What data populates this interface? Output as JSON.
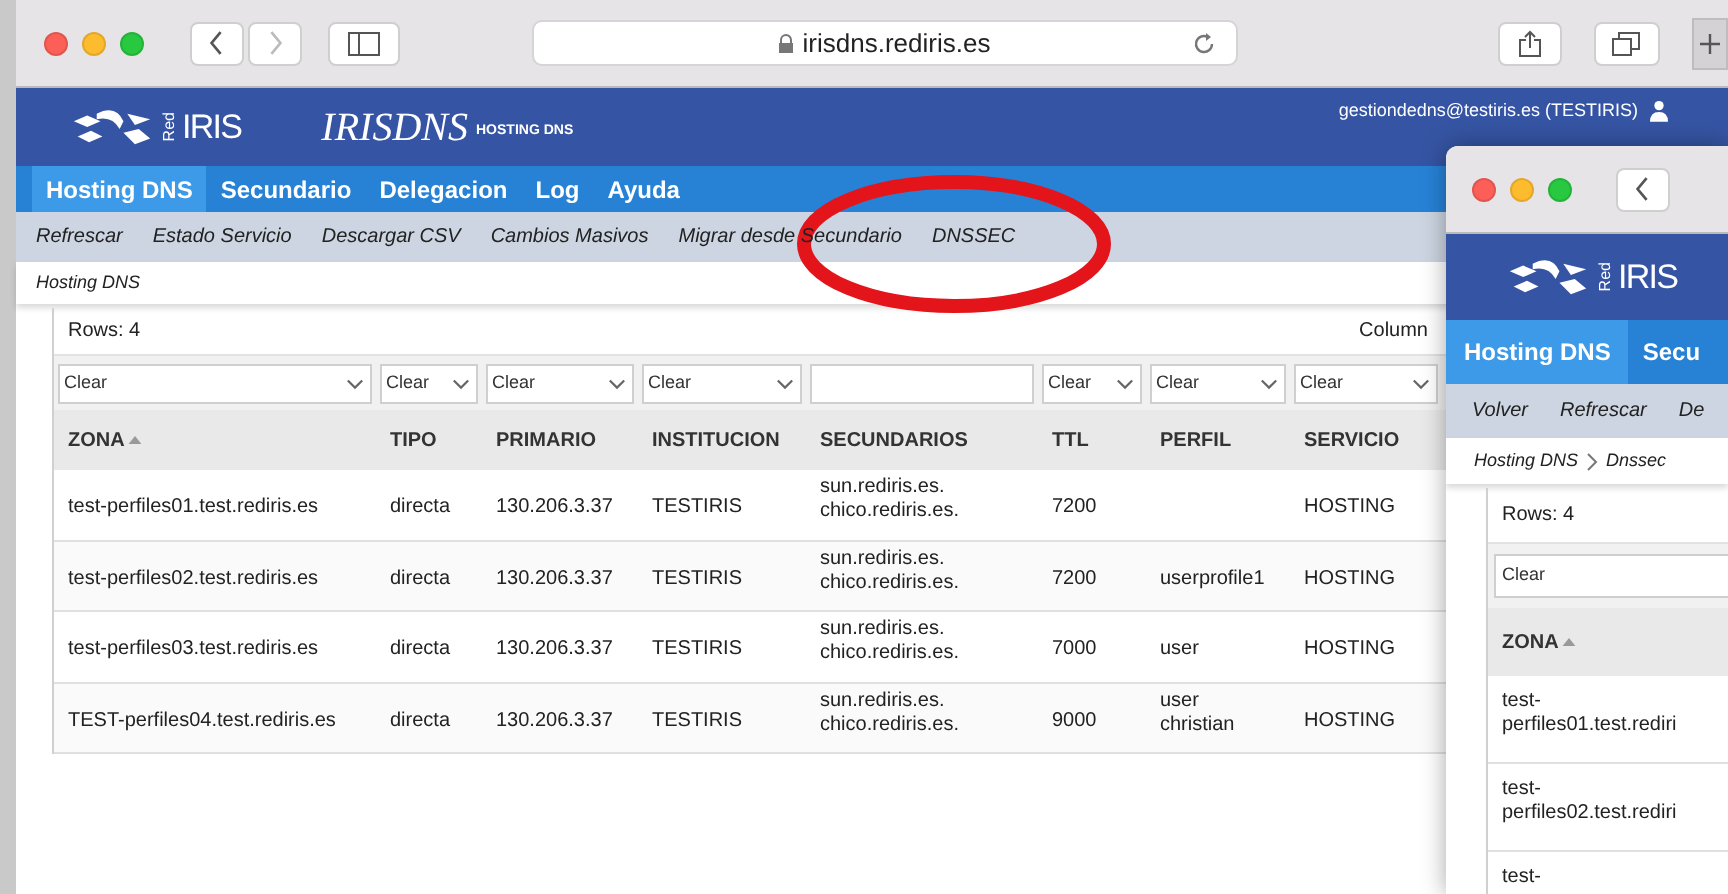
{
  "browser": {
    "url": "irisdns.rediris.es"
  },
  "app": {
    "brand_prefix": "Red",
    "brand": "IRIS",
    "title": "IRISDNS",
    "subtitle": "HOSTING DNS",
    "user": "gestiondedns@testiris.es (TESTIRIS)"
  },
  "nav": [
    {
      "label": "Hosting DNS",
      "selected": true
    },
    {
      "label": "Secundario",
      "selected": false
    },
    {
      "label": "Delegacion",
      "selected": false
    },
    {
      "label": "Log",
      "selected": false
    },
    {
      "label": "Ayuda",
      "selected": false
    }
  ],
  "actions": [
    "Refrescar",
    "Estado Servicio",
    "Descargar CSV",
    "Cambios Masivos",
    "Migrar desde Secundario",
    "DNSSEC"
  ],
  "breadcrumb": [
    "Hosting DNS"
  ],
  "grid": {
    "rows_count": "Rows: 4",
    "columns_button": "Column",
    "filters": [
      {
        "kind": "select",
        "value": "Clear"
      },
      {
        "kind": "select",
        "value": "Clear"
      },
      {
        "kind": "select",
        "value": "Clear"
      },
      {
        "kind": "select",
        "value": "Clear"
      },
      {
        "kind": "text"
      },
      {
        "kind": "select",
        "value": "Clear"
      },
      {
        "kind": "select",
        "value": "Clear"
      },
      {
        "kind": "select",
        "value": "Clear"
      }
    ],
    "columns": [
      {
        "label": "ZONA",
        "sorted": true
      },
      {
        "label": "TIPO",
        "sorted": false
      },
      {
        "label": "PRIMARIO",
        "sorted": false
      },
      {
        "label": "INSTITUCION",
        "sorted": false
      },
      {
        "label": "SECUNDARIOS",
        "sorted": false
      },
      {
        "label": "TTL",
        "sorted": false
      },
      {
        "label": "PERFIL",
        "sorted": false
      },
      {
        "label": "SERVICIO",
        "sorted": false
      }
    ],
    "rows": [
      [
        "test-perfiles01.test.rediris.es",
        "directa",
        "130.206.3.37",
        "TESTIRIS",
        "sun.rediris.es.\nchico.rediris.es.",
        "7200",
        "",
        "HOSTING"
      ],
      [
        "test-perfiles02.test.rediris.es",
        "directa",
        "130.206.3.37",
        "TESTIRIS",
        "sun.rediris.es.\nchico.rediris.es.",
        "7200",
        "userprofile1",
        "HOSTING"
      ],
      [
        "test-perfiles03.test.rediris.es",
        "directa",
        "130.206.3.37",
        "TESTIRIS",
        "sun.rediris.es.\nchico.rediris.es.",
        "7000",
        "user",
        "HOSTING"
      ],
      [
        "TEST-perfiles04.test.rediris.es",
        "directa",
        "130.206.3.37",
        "TESTIRIS",
        "sun.rediris.es.\nchico.rediris.es.",
        "9000",
        "user\nchristian",
        "HOSTING"
      ]
    ]
  },
  "annotation": {
    "kind": "ellipse"
  },
  "second_window": {
    "brand_prefix": "Red",
    "brand": "IRIS",
    "nav": [
      {
        "label": "Hosting DNS",
        "selected": true
      },
      {
        "label": "Secu",
        "selected": false
      }
    ],
    "actions": [
      "Volver",
      "Refrescar",
      "De"
    ],
    "breadcrumb": [
      "Hosting DNS",
      "Dnssec"
    ],
    "rows_count": "Rows: 4",
    "filter": "Clear",
    "column": {
      "label": "ZONA",
      "sorted": true
    },
    "rows": [
      "test-\nperfiles01.test.rediri",
      "test-\nperfiles02.test.rediri",
      "test-"
    ]
  }
}
